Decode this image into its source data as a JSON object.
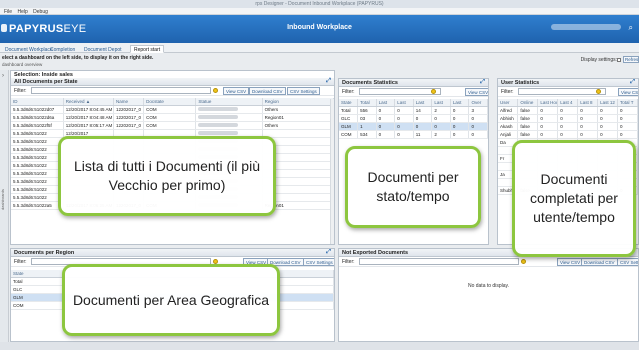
{
  "window_title": "rps Designer - Document Inbound Workplace (PAPYRUS)",
  "menu": [
    "File",
    "Help",
    "Debug"
  ],
  "app": {
    "logo_main": "PAPYRUS",
    "logo_sub": "EYE",
    "title": "Inbound Workplace"
  },
  "tabs": [
    "Document Workplace",
    "Completion",
    "Document Depot",
    "Report start"
  ],
  "active_tab": 3,
  "hint": "elect a dashboard on the left side, to display it on the right side.",
  "crumb": "dashboard overview",
  "display_settings_label": "Display settings:",
  "refresh_label": "Refresh tile",
  "panels": {
    "docs_per_state": {
      "selection": "Selection: Inside sales",
      "title": "All Documents per State",
      "filter_label": "Filter:",
      "buttons": [
        "View CSV",
        "Download CSV",
        "CSV Settings"
      ],
      "columns": [
        "ID",
        "Received ▲",
        "Name",
        "Docstate",
        "Statue",
        "Region"
      ],
      "rows": [
        [
          "5.5.3d8d6:51022d07",
          "12/20/2017 8:04:45 AM",
          "12202017_0",
          "COM",
          "",
          "Others"
        ],
        [
          "5.5.3d8d6:51022d6a",
          "12/20/2017 8:04:48 AM",
          "12202017_0",
          "COM",
          "",
          "Region01"
        ],
        [
          "5.5.3d8d6:51022f5f",
          "12/20/2017 8:05:17 AM",
          "12202017_0",
          "COM",
          "",
          "Others"
        ],
        [
          "5.5.3d8d6:51022",
          "12/20/2017",
          "",
          "",
          "",
          ""
        ],
        [
          "5.5.3d8d6:51022",
          "",
          "",
          "",
          "",
          ""
        ],
        [
          "5.5.3d8d6:51022",
          "",
          "",
          "",
          "",
          ""
        ],
        [
          "5.5.3d8d6:51022",
          "",
          "",
          "",
          "",
          ""
        ],
        [
          "5.5.3d8d6:51022",
          "",
          "",
          "",
          "",
          ""
        ],
        [
          "5.5.3d8d6:51022",
          "",
          "",
          "",
          "",
          ""
        ],
        [
          "5.5.3d8d6:51022",
          "",
          "",
          "",
          "",
          ""
        ],
        [
          "5.5.3d8d6:51022",
          "",
          "",
          "",
          "",
          ""
        ],
        [
          "5.5.3d8d6:51022",
          "",
          "",
          "",
          "",
          ""
        ],
        [
          "5.5.3d8d6:51022a5",
          "12/20/2017 8:06:25 AM",
          "12202017_0",
          "COM",
          "",
          "Region01"
        ]
      ]
    },
    "doc_stats": {
      "title": "Documents Statistics",
      "filter_label": "Filter:",
      "buttons": [
        "View CSV"
      ],
      "columns": [
        "State",
        "Total",
        "Last",
        "Last",
        "Last",
        "Last",
        "Last",
        "Over"
      ],
      "rows": [
        [
          "Total",
          "556",
          "0",
          "0",
          "14",
          "2",
          "0",
          "3",
          "3"
        ],
        [
          "GLC",
          "03",
          "0",
          "0",
          "0",
          "0",
          "0",
          "0",
          "0"
        ],
        [
          "GLM",
          "1",
          "0",
          "0",
          "0",
          "0",
          "0",
          "0",
          "0"
        ],
        [
          "COM",
          "534",
          "0",
          "0",
          "11",
          "2",
          "0",
          "0",
          "0"
        ]
      ]
    },
    "user_stats": {
      "title": "User Statistics",
      "filter_label": "Filter:",
      "buttons": [
        "View CSV"
      ],
      "columns": [
        "User",
        "Online",
        "Last Hou",
        "Last 4",
        "Last 8",
        "Last 12",
        "Total T"
      ],
      "rows": [
        [
          "Alfred",
          "false",
          "0",
          "0",
          "0",
          "0",
          "0"
        ],
        [
          "Abhish",
          "false",
          "0",
          "0",
          "0",
          "0",
          "0"
        ],
        [
          "Akash",
          "false",
          "0",
          "0",
          "0",
          "0",
          "0"
        ],
        [
          "Anjali",
          "false",
          "0",
          "0",
          "0",
          "0",
          "0"
        ],
        [
          "Da",
          "",
          "",
          "",
          "",
          "",
          ""
        ],
        [
          "",
          "",
          "",
          "",
          "",
          "",
          ""
        ],
        [
          "Fr",
          "",
          "",
          "",
          "",
          "",
          ""
        ],
        [
          "",
          "",
          "",
          "",
          "",
          "",
          ""
        ],
        [
          "Ja",
          "",
          "",
          "",
          "",
          "",
          ""
        ],
        [
          "",
          "",
          "",
          "",
          "",
          "",
          ""
        ],
        [
          "Shubh",
          "false",
          "0",
          "0",
          "0",
          "0",
          "0"
        ]
      ]
    },
    "docs_per_region": {
      "title": "Documents per Region",
      "filter_label": "Filter:",
      "buttons": [
        "View CSV",
        "Download CSV",
        "CSV Settings"
      ],
      "columns": [
        "State"
      ],
      "rows": [
        [
          "Total"
        ],
        [
          "GLC"
        ],
        [
          "GLM"
        ],
        [
          "COM"
        ]
      ]
    },
    "not_exported": {
      "title": "Not Exported Documents",
      "filter_label": "Filter:",
      "buttons": [
        "View CSV",
        "Download CSV",
        "CSV Settings"
      ],
      "no_data": "No data to display."
    }
  },
  "callouts": {
    "all_docs": "Lista di tutti i Documenti (il più Vecchio per primo)",
    "per_state": "Documenti per stato/tempo",
    "per_user": "Documenti completati per utente/tempo",
    "per_region": "Documenti per Area Geografica"
  },
  "colors": {
    "appbar": "#1f63ae",
    "callout_border": "#8dc63f",
    "selected_row": "#cfe0f3"
  }
}
